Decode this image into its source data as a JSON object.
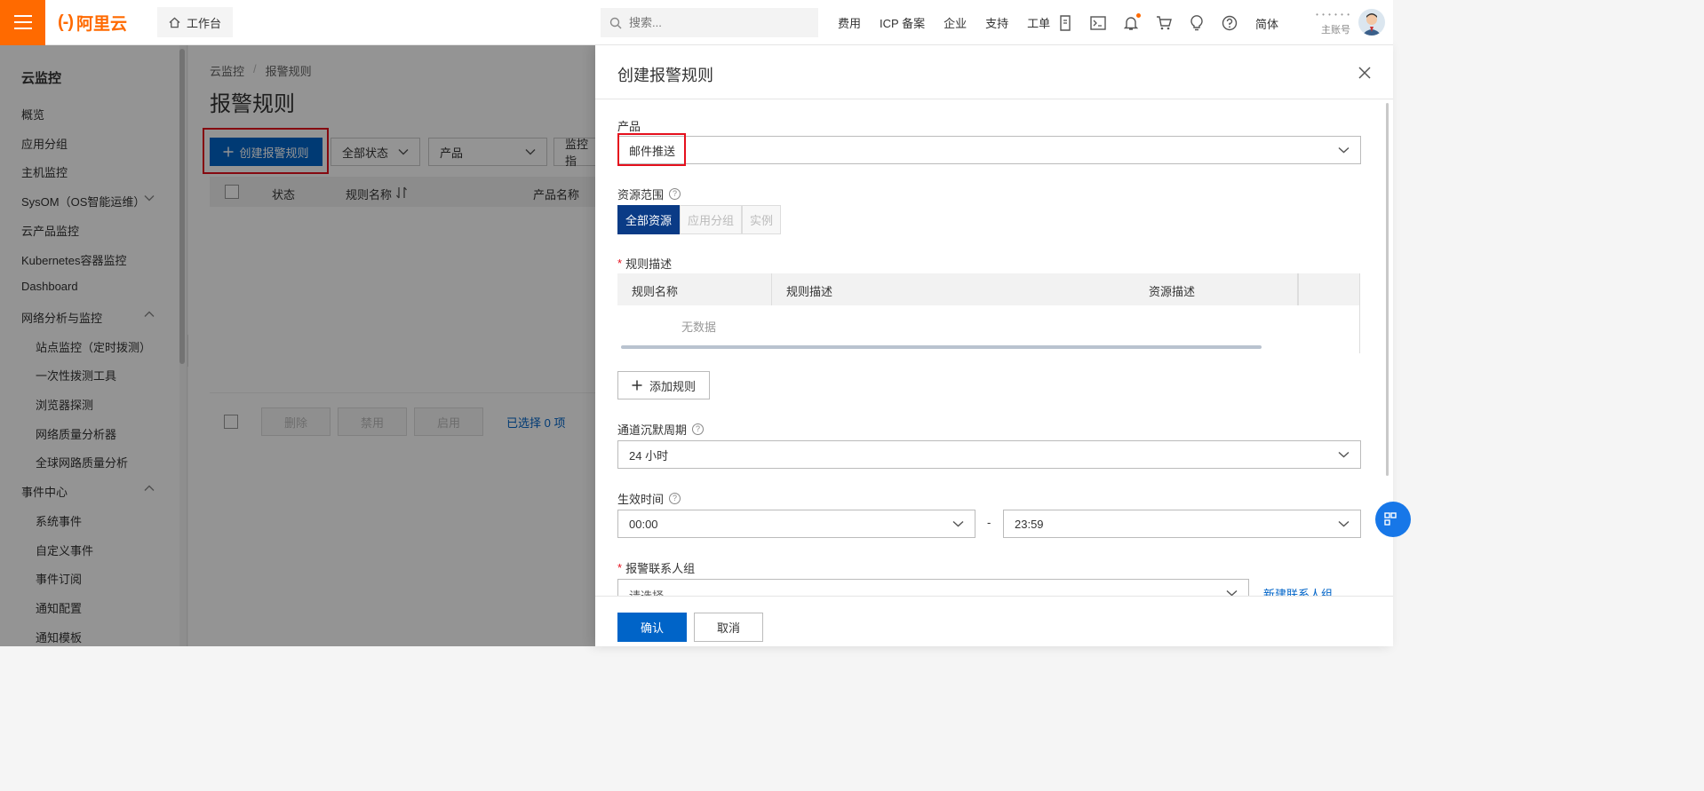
{
  "topbar": {
    "logo_mark": "(-)",
    "logo_text": "阿里云",
    "workbench": "工作台",
    "search_placeholder": "搜索...",
    "links": [
      "费用",
      "ICP 备案",
      "企业",
      "支持",
      "工单"
    ],
    "lang": "简体",
    "account_name": "• • • • • •",
    "account_role": "主账号",
    "accent": "#ff6a00"
  },
  "sidebar": {
    "title": "云监控",
    "items": [
      {
        "label": "概览",
        "sub": false
      },
      {
        "label": "应用分组",
        "sub": false
      },
      {
        "label": "主机监控",
        "sub": false
      },
      {
        "label": "SysOM（OS智能运维）",
        "sub": false,
        "chevron": "down"
      },
      {
        "label": "云产品监控",
        "sub": false
      },
      {
        "label": "Kubernetes容器监控",
        "sub": false
      },
      {
        "label": "Dashboard",
        "sub": false
      },
      {
        "label": "网络分析与监控",
        "sub": false,
        "chevron": "up"
      },
      {
        "label": "站点监控（定时拨测）",
        "sub": true
      },
      {
        "label": "一次性拨测工具",
        "sub": true
      },
      {
        "label": "浏览器探测",
        "sub": true
      },
      {
        "label": "网络质量分析器",
        "sub": true
      },
      {
        "label": "全球网路质量分析",
        "sub": true
      },
      {
        "label": "事件中心",
        "sub": false,
        "chevron": "up"
      },
      {
        "label": "系统事件",
        "sub": true
      },
      {
        "label": "自定义事件",
        "sub": true
      },
      {
        "label": "事件订阅",
        "sub": true
      },
      {
        "label": "通知配置",
        "sub": true
      },
      {
        "label": "通知模板",
        "sub": true
      }
    ]
  },
  "main": {
    "breadcrumb": [
      "云监控",
      "报警规则"
    ],
    "title": "报警规则",
    "create_button": "创建报警规则",
    "filters": [
      "全部状态",
      "产品",
      "监控指"
    ],
    "table_headers": [
      "状态",
      "规则名称",
      "产品名称"
    ],
    "bulk_buttons": [
      "删除",
      "禁用",
      "启用"
    ],
    "selected_text": "已选择 0 项"
  },
  "drawer": {
    "title": "创建报警规则",
    "product_label": "产品",
    "product_value": "邮件推送",
    "scope_label": "资源范围",
    "scope_options": [
      "全部资源",
      "应用分组",
      "实例"
    ],
    "rule_desc_label": "规则描述",
    "rule_table_headers": [
      "规则名称",
      "规则描述",
      "资源描述"
    ],
    "no_data": "无数据",
    "add_rule": "添加规则",
    "silence_label": "通道沉默周期",
    "silence_value": "24 小时",
    "effective_label": "生效时间",
    "effective_start": "00:00",
    "effective_dash": "-",
    "effective_end": "23:59",
    "contact_label": "报警联系人组",
    "contact_placeholder": "请选择",
    "new_contact_group": "新建联系人组",
    "confirm": "确认",
    "cancel": "取消"
  },
  "colors": {
    "primary": "#0064c8",
    "highlight": "#e5101d",
    "segment_active": "#0a3b86"
  }
}
